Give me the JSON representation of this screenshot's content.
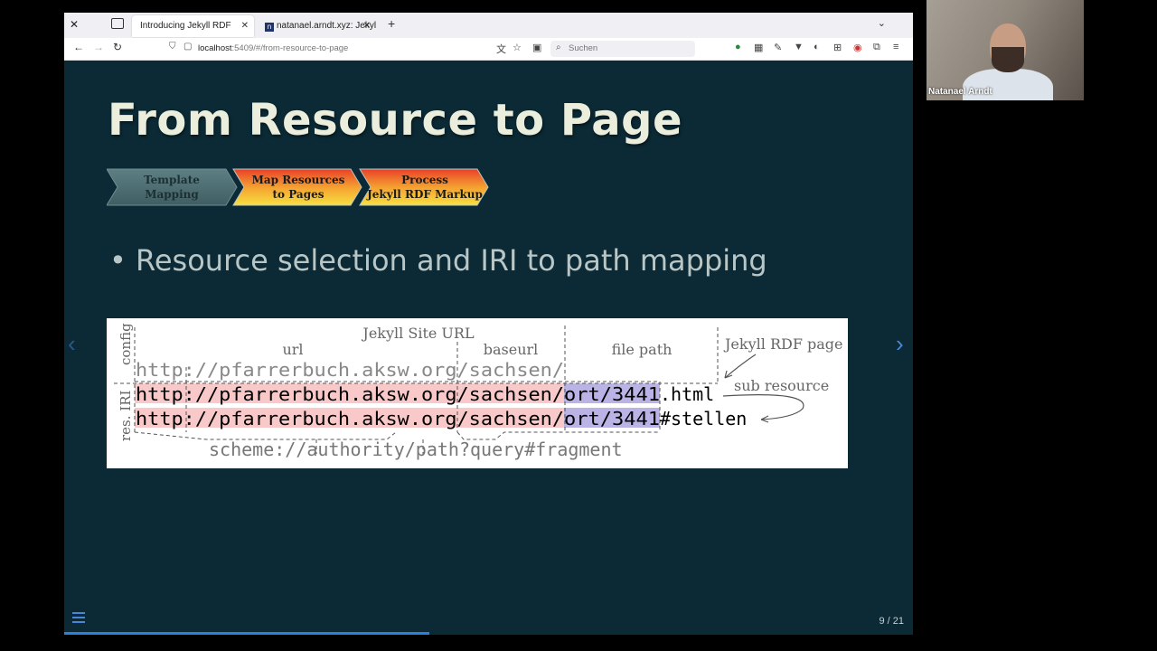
{
  "browser": {
    "tabs": [
      {
        "label": "Introducing Jekyll RDF",
        "active": true
      },
      {
        "label": "natanael.arndt.xyz: Jekyll",
        "active": false
      }
    ],
    "url_host": "localhost",
    "url_rest": ":5409/#/from-resource-to-page",
    "search_placeholder": "Suchen"
  },
  "slide": {
    "title": "From Resource to Page",
    "steps": [
      {
        "line1": "Template",
        "line2": "Mapping",
        "active": false
      },
      {
        "line1": "Map Resources",
        "line2": "to Pages",
        "active": true
      },
      {
        "line1": "Process",
        "line2": "Jekyll RDF Markup",
        "active": true
      }
    ],
    "bullet": "Resource selection and IRI to path mapping",
    "diagram": {
      "label_config": "config",
      "label_res_iri": "res. IRI",
      "label_site_url": "Jekyll Site URL",
      "label_url": "url",
      "label_baseurl": "baseurl",
      "label_file_path": "file path",
      "label_rdf_page": "Jekyll RDF page",
      "label_sub_resource": "sub resource",
      "config_line": "http://pfarrerbuch.aksw.org/sachsen/",
      "iri_prefix": "http://pfarrerbuch.aksw.org/sachsen/",
      "iri_path": "ort/3441",
      "iri1_suffix": ".html",
      "iri2_suffix": "#stellen",
      "uri_scheme": "scheme://authority/path?query#fragment"
    },
    "page_number": "9 / 21",
    "progress_percent": 43
  },
  "video": {
    "participant_name": "Natanael Arndt"
  },
  "colors": {
    "slide_bg": "#0b2a35",
    "title": "#eceedd",
    "accent": "#4a86d8",
    "highlight_red": "#f9c9c9",
    "highlight_blue": "#b9b3e6"
  }
}
